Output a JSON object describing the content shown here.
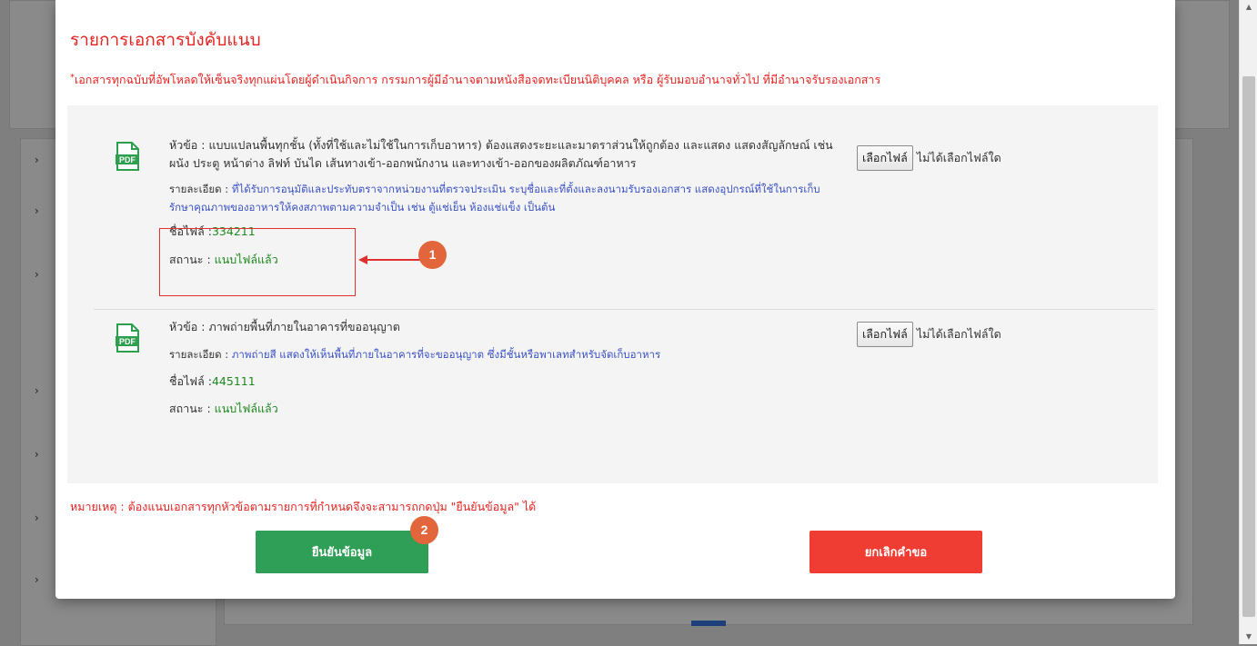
{
  "modal": {
    "title": "รายการเอกสารบังคับแนบ",
    "notice_star": "*",
    "notice": "เอกสารทุกฉบับที่อัพโหลดให้เซ็นจริงทุกแผ่นโดยผู้ดำเนินกิจการ กรรมการผู้มีอำนาจตามหนังสือจดทะเบียนนิติบุคคล หรือ ผู้รับมอบอำนาจทั่วไป ที่มีอำนาจรับรองเอกสาร",
    "footnote": "หมายเหตุ : ต้องแนบเอกสารทุกหัวข้อตามรายการที่กำหนดจึงจะสามารถกดปุ่ม \"ยืนยันข้อมูล\" ได้",
    "confirm_label": "ยืนยันข้อมูล",
    "cancel_label": "ยกเลิกคำขอ"
  },
  "labels": {
    "topic": "หัวข้อ : ",
    "detail": "รายละเอียด : ",
    "file": "ชื่อไฟล์ :",
    "status": "สถานะ : "
  },
  "file_picker": {
    "button_label": "เลือกไฟล์",
    "none_text": "ไม่ได้เลือกไฟล์ใด"
  },
  "documents": [
    {
      "icon": "pdf-icon",
      "topic": "แบบแปลนพื้นทุกชั้น (ทั้งที่ใช้และไม่ใช้ในการเก็บอาหาร) ต้องแสดงระยะและมาตราส่วนให้ถูกต้อง และแสดง แสดงสัญลักษณ์ เช่น ผนัง ประตู หน้าต่าง ลิฟท์ บันได เส้นทางเข้า-ออกพนักงาน และทางเข้า-ออกของผลิตภัณฑ์อาหาร",
      "detail": "ที่ได้รับการอนุมัติและประทับตราจากหน่วยงานที่ตรวจประเมิน ระบุชื่อและที่ตั้งและลงนามรับรองเอกสาร แสดงอุปกรณ์ที่ใช้ในการเก็บรักษาคุณภาพของอาหารให้คงสภาพตามความจำเป็น เช่น ตู้แช่เย็น ห้องแช่แข็ง เป็นต้น",
      "file_name": "334211",
      "status": "แนบไฟล์แล้ว"
    },
    {
      "icon": "pdf-icon",
      "topic": "ภาพถ่ายพื้นที่ภายในอาคารที่ขออนุญาต",
      "detail": "ภาพถ่ายสี แสดงให้เห็นพื้นที่ภายในอาคารที่จะขออนุญาต ซึ่งมีชั้นหรือพาเลทสำหรับจัดเก็บอาหาร",
      "file_name": "445111",
      "status": "แนบไฟล์แล้ว"
    }
  ],
  "annotations": {
    "badge_1": "1",
    "badge_2": "2",
    "highlight_color": "#e03030",
    "badge_color": "#e2653c"
  },
  "background_sidebar_marks": [
    "›",
    "›",
    "›",
    "›",
    "›",
    "›",
    "›"
  ]
}
